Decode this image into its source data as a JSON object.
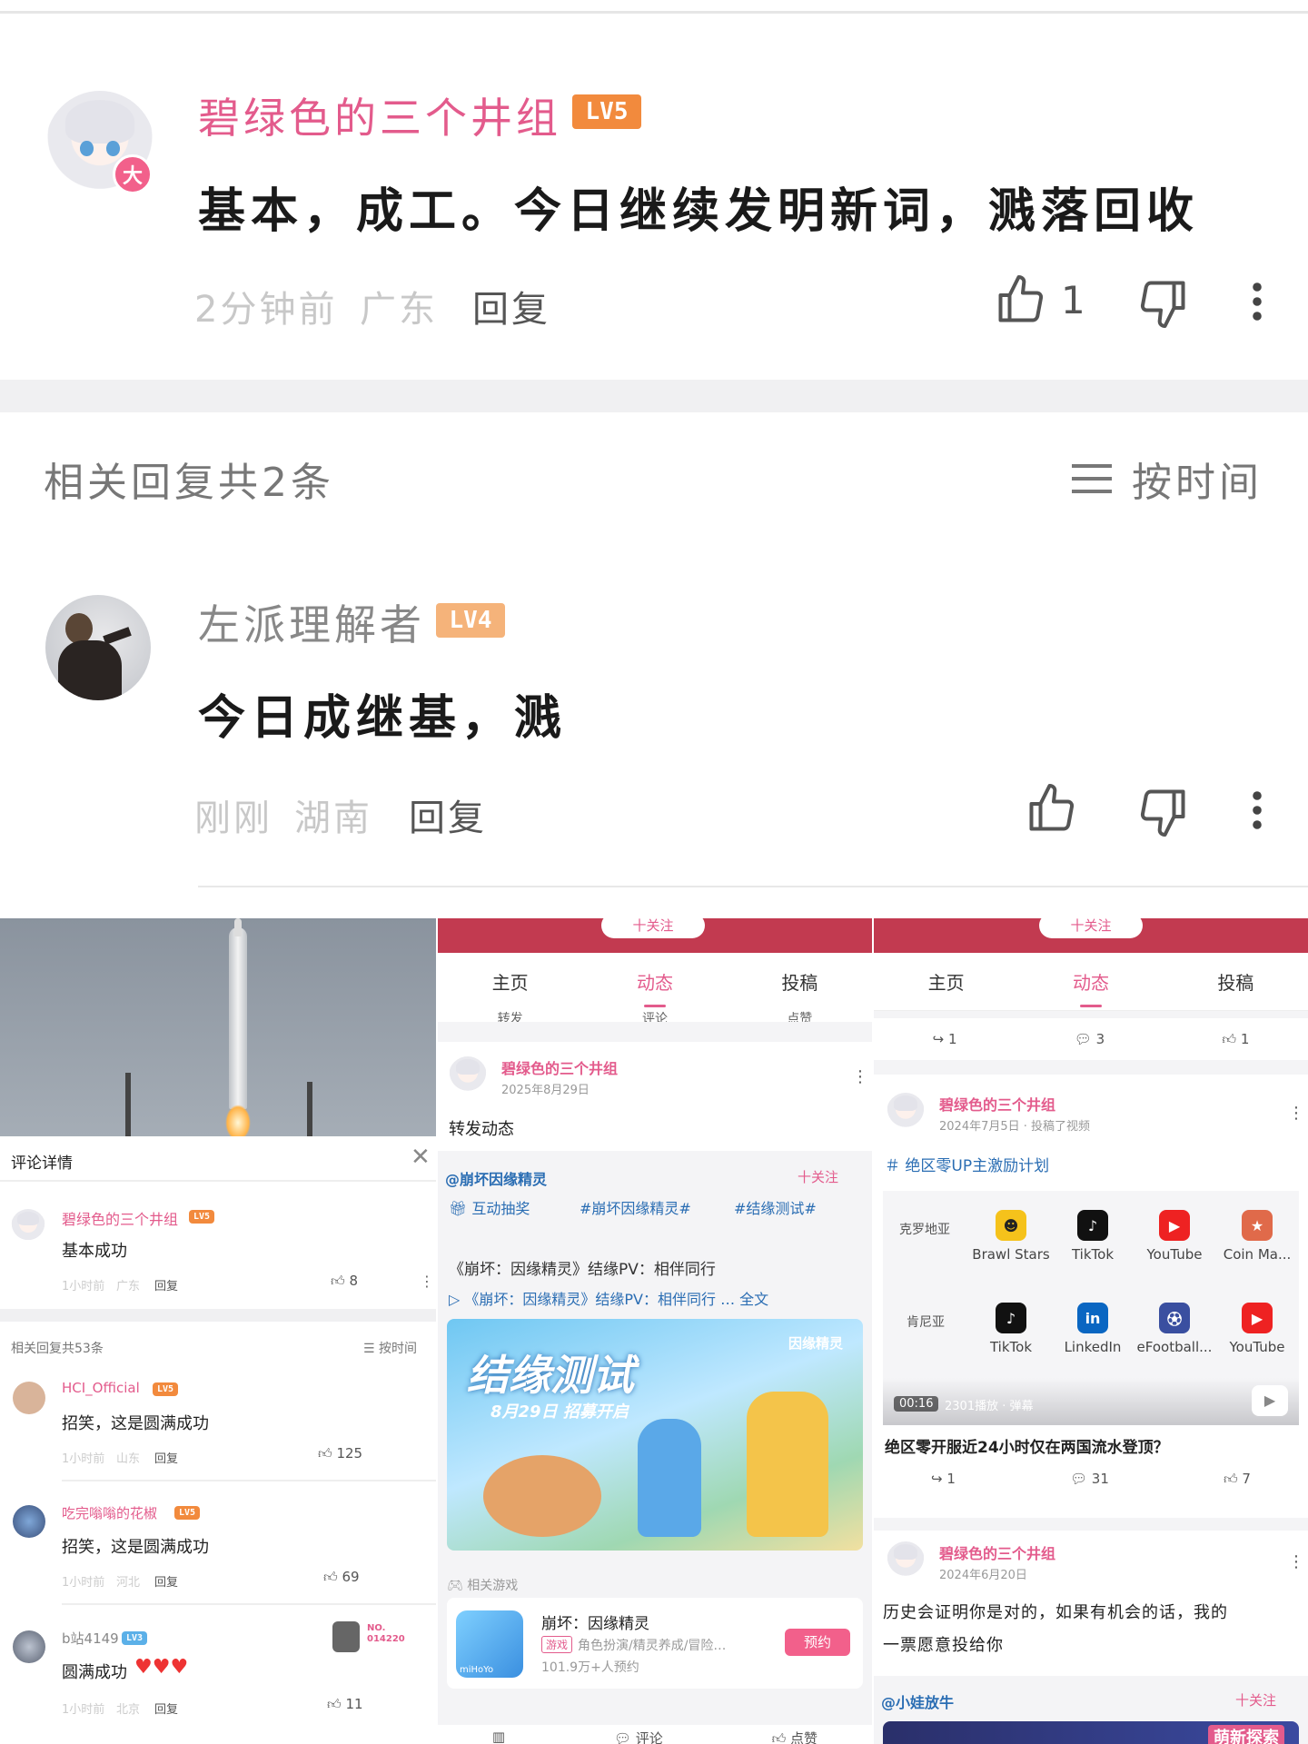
{
  "main_comment": {
    "username": "碧绿色的三个井组",
    "level": "LV5",
    "badge": "大",
    "text": "基本，成工。今日继续发明新词，溅落回收",
    "time": "2分钟前",
    "location": "广东",
    "reply_label": "回复",
    "like_count": "1"
  },
  "related": {
    "title": "相关回复共2条",
    "sort_label": "按时间"
  },
  "reply_comment": {
    "username": "左派理解者",
    "level": "LV4",
    "text": "今日成继基，溅",
    "time": "刚刚",
    "location": "湖南",
    "reply_label": "回复"
  },
  "panel_a": {
    "header": "评论详情",
    "main": {
      "username": "碧绿色的三个井组",
      "level": "LV5",
      "text": "基本成功",
      "time": "1小时前",
      "location": "广东",
      "reply": "回复",
      "likes": "8"
    },
    "related_title": "相关回复共53条",
    "sort_label": "按时间",
    "replies": [
      {
        "username": "HCI_Official",
        "level": "LV5",
        "text": "招笑，这是圆满成功",
        "time": "1小时前",
        "location": "山东",
        "reply": "回复",
        "likes": "125"
      },
      {
        "username": "吃完嗡嗡的花椒",
        "level": "LV5",
        "text": "招笑，这是圆满成功",
        "time": "1小时前",
        "location": "河北",
        "reply": "回复",
        "likes": "69"
      },
      {
        "username": "b站4149",
        "level": "LV3",
        "text": "圆满成功",
        "time": "1小时前",
        "location": "北京",
        "reply": "回复",
        "likes": "11"
      }
    ],
    "no_label": "NO.",
    "no_value": "014220"
  },
  "panel_b": {
    "follow": "十关注",
    "tabs": [
      "主页",
      "动态",
      "投稿"
    ],
    "actions": [
      "转发",
      "评论",
      "点赞"
    ],
    "post": {
      "username": "碧绿色的三个井组",
      "date": "2025年8月29日",
      "text": "转发动态"
    },
    "repost": {
      "author": "@崩坏因缘精灵",
      "follow": "十关注",
      "tags": [
        "互动抽奖",
        "#崩坏因缘精灵#",
        "#结缘测试#"
      ],
      "title": "《崩坏：因缘精灵》结缘PV：相伴同行",
      "link": "《崩坏：因缘精灵》结缘PV：相伴同行 … 全文",
      "banner_title": "结缘测试",
      "banner_sub": "8月29日 招募开启",
      "banner_logo": "因缘精灵"
    },
    "game": {
      "section": "相关游戏",
      "name": "崩坏：因缘精灵",
      "tag": "游戏",
      "desc": "角色扮演/精灵养成/冒险…",
      "count": "101.9万+人预约",
      "button": "预约",
      "maker": "miHoYo"
    },
    "bottom_actions": [
      "评论",
      "点赞"
    ]
  },
  "panel_c": {
    "follow": "十关注",
    "tabs": [
      "主页",
      "动态",
      "投稿"
    ],
    "counts_top": [
      "1",
      "3",
      "1"
    ],
    "post1": {
      "username": "碧绿色的三个井组",
      "date": "2024年7月5日 · 投稿了视频",
      "topic": "绝区零UP主激励计划",
      "video_time": "00:16",
      "video_meta": "2301播放 · 弹幕",
      "title": "绝区零开服近24小时仅在两国流水登顶？",
      "counts": [
        "1",
        "31",
        "7"
      ]
    },
    "grid_rows": [
      {
        "country": "克罗地亚",
        "apps": [
          "Brawl Stars",
          "TikTok",
          "YouTube",
          "Coin Ma..."
        ]
      },
      {
        "country": "肯尼亚",
        "apps": [
          "TikTok",
          "LinkedIn",
          "eFootball...",
          "YouTube"
        ]
      }
    ],
    "post2": {
      "username": "碧绿色的三个井组",
      "date": "2024年6月20日",
      "text1": "历史会证明你是对的，如果有机会的话，我的",
      "text2": "一票愿意投给你"
    },
    "post3": {
      "author": "@小娃放牛",
      "follow": "十关注",
      "banner": "萌新探索"
    }
  },
  "colors": {
    "pink": "#e35b8c",
    "lv5": "#f28a3d",
    "lv4": "#f5b37a",
    "lv3": "#5bb0e8"
  }
}
